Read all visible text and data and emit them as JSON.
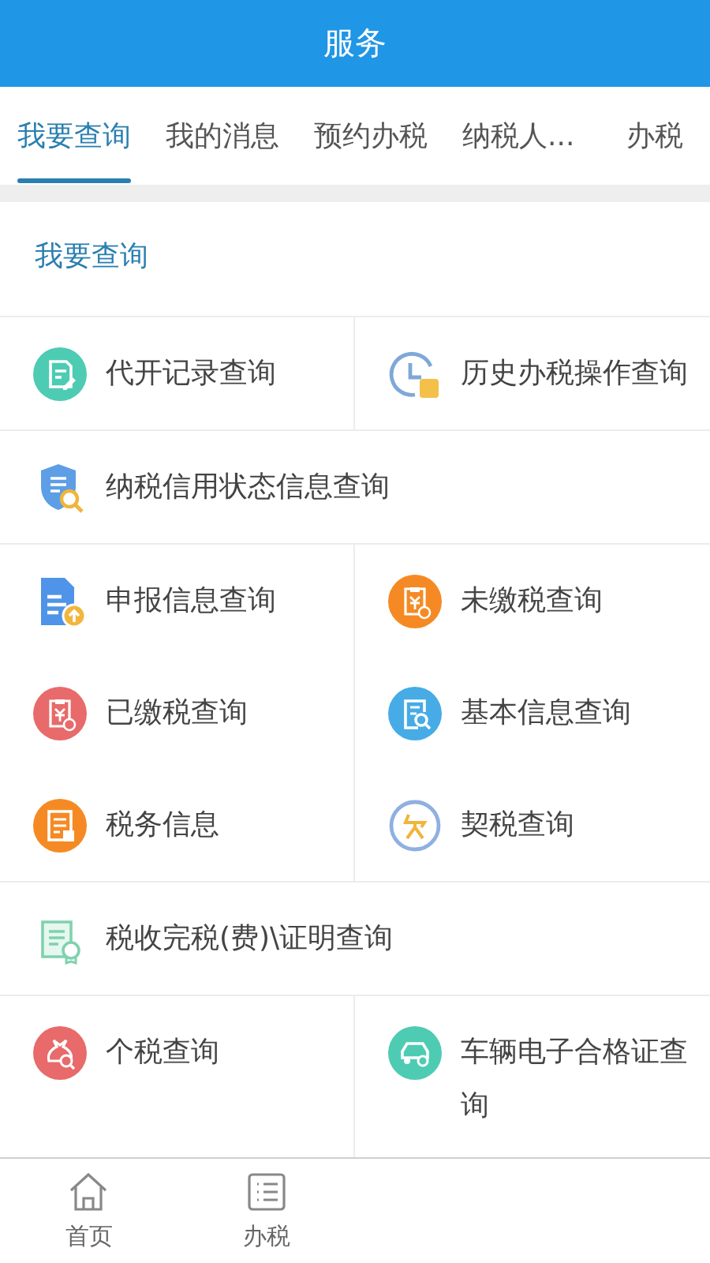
{
  "header": {
    "title": "服务"
  },
  "tabs": [
    {
      "label": "我要查询",
      "selected": true
    },
    {
      "label": "我的消息",
      "selected": false
    },
    {
      "label": "预约办税",
      "selected": false
    },
    {
      "label": "纳税人...",
      "selected": false
    },
    {
      "label": "办税",
      "selected": false
    }
  ],
  "section": {
    "title": "我要查询"
  },
  "blocks": [
    {
      "items": [
        {
          "label": "代开记录查询",
          "kind": "edit"
        },
        {
          "label": "历史办税操作查询",
          "kind": "clock"
        }
      ]
    },
    {
      "items": [
        {
          "label": "纳税信用状态信息查询",
          "kind": "shield"
        }
      ]
    },
    {
      "items": [
        {
          "label": "申报信息查询",
          "kind": "upload"
        },
        {
          "label": "未缴税查询",
          "kind": "unpaid"
        },
        {
          "label": "已缴税查询",
          "kind": "paid"
        },
        {
          "label": "基本信息查询",
          "kind": "search"
        },
        {
          "label": "税务信息",
          "kind": "doc"
        },
        {
          "label": "契税查询",
          "kind": "ring"
        }
      ]
    },
    {
      "items": [
        {
          "label": "税收完税(费)\\证明查询",
          "kind": "certificate"
        }
      ]
    },
    {
      "items": [
        {
          "label": "个税查询",
          "kind": "bag"
        },
        {
          "label": "车辆电子合格证查询",
          "kind": "car"
        }
      ]
    }
  ],
  "bottom_nav": [
    {
      "label": "首页",
      "kind": "home"
    },
    {
      "label": "办税",
      "kind": "list"
    }
  ]
}
